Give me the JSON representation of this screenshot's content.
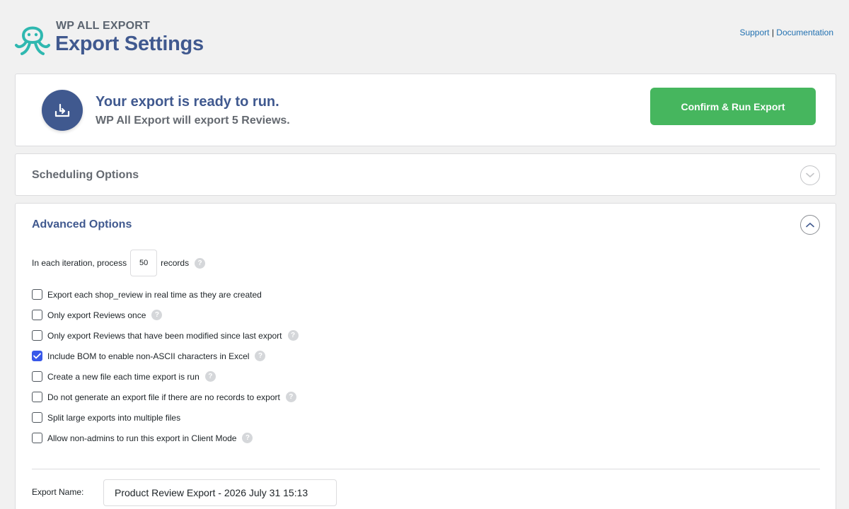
{
  "header": {
    "brand_small": "WP ALL EXPORT",
    "title": "Export Settings",
    "support_link": "Support",
    "separator": "|",
    "documentation_link": "Documentation"
  },
  "ready": {
    "icon": "download-tray-icon",
    "title": "Your export is ready to run.",
    "subtitle": "WP All Export will export 5 Reviews.",
    "run_button": "Confirm & Run Export"
  },
  "scheduling": {
    "heading": "Scheduling Options",
    "expanded": false
  },
  "advanced": {
    "heading": "Advanced Options",
    "expanded": true,
    "iteration": {
      "prefix": "In each iteration, process",
      "value": "50",
      "suffix": "records"
    },
    "options": [
      {
        "label": "Export each shop_review in real time as they are created",
        "checked": false,
        "help": false
      },
      {
        "label": "Only export Reviews once",
        "checked": false,
        "help": true
      },
      {
        "label": "Only export Reviews that have been modified since last export",
        "checked": false,
        "help": true
      },
      {
        "label": "Include BOM to enable non-ASCII characters in Excel",
        "checked": true,
        "help": true
      },
      {
        "label": "Create a new file each time export is run",
        "checked": false,
        "help": true
      },
      {
        "label": "Do not generate an export file if there are no records to export",
        "checked": false,
        "help": true
      },
      {
        "label": "Split large exports into multiple files",
        "checked": false,
        "help": false
      },
      {
        "label": "Allow non-admins to run this export in Client Mode",
        "checked": false,
        "help": true
      }
    ],
    "export_name_label": "Export Name:",
    "export_name_value": "Product Review Export - 2026 July 31 15:13"
  },
  "colors": {
    "brand_blue": "#40598f",
    "logo_teal": "#2fb8b0",
    "run_green": "#46b65e",
    "checkbox_blue": "#3858e9",
    "link_blue": "#2271b1"
  }
}
